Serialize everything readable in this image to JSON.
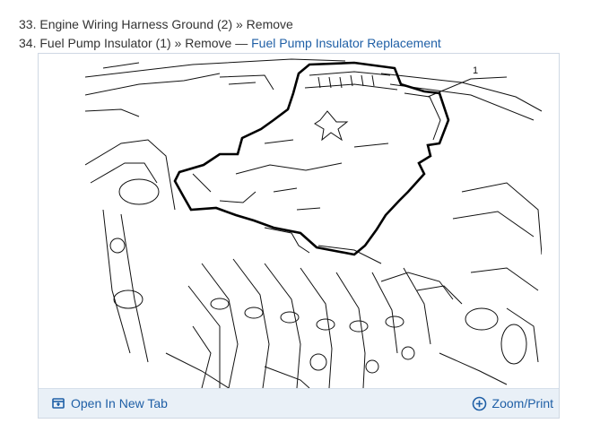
{
  "steps": [
    {
      "number": "33.",
      "text": "Engine Wiring Harness Ground (2) » Remove",
      "link": ""
    },
    {
      "number": "34.",
      "text": "Fuel Pump Insulator (1) » Remove — ",
      "link": "Fuel Pump Insulator Replacement"
    }
  ],
  "figure": {
    "callout": "1",
    "open_tab_label": "Open In New Tab",
    "zoom_label": "Zoom/Print"
  },
  "colors": {
    "link": "#1f5fa6",
    "text": "#333333",
    "footer_bg": "#e9f0f7",
    "border": "#cfd8e3"
  }
}
